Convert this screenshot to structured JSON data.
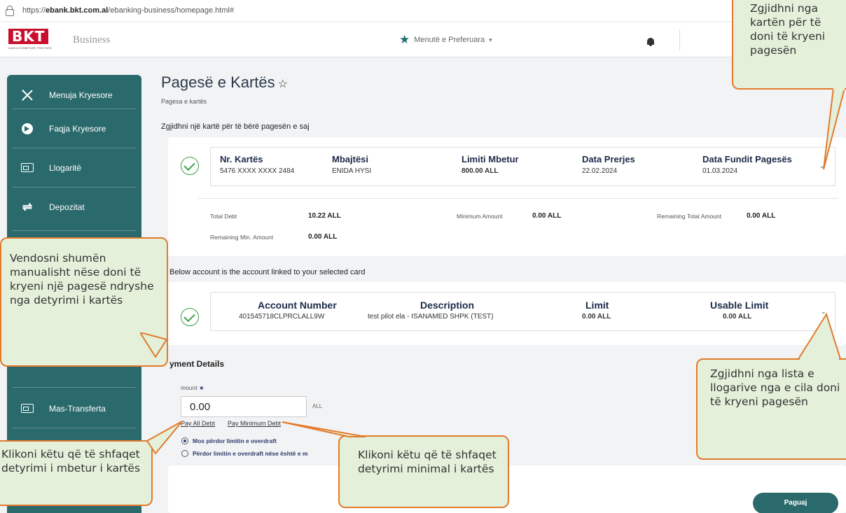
{
  "browser": {
    "url_prefix": "https://",
    "url_domain": "ebank.bkt.com.al",
    "url_path": "/ebanking-business/homepage.html#"
  },
  "header": {
    "logo_text": "BKT",
    "logo_sub": "BANKA KOMBËTARE TREGTARE",
    "business": "Business",
    "favorites": "Menutë e Preferuara",
    "favorites_icon": "star-icon"
  },
  "sidebar": {
    "items": [
      {
        "label": "Menuja Kryesore",
        "icon": "close-icon"
      },
      {
        "label": "Faqja Kryesore",
        "icon": "home-circle-icon"
      },
      {
        "label": "Llogaritë",
        "icon": "account-card-icon"
      },
      {
        "label": "Depozitat",
        "icon": "deposit-icon"
      },
      {
        "label": "Mas-Transferta",
        "icon": "account-card-icon"
      }
    ]
  },
  "main": {
    "title": "Pagesë e Kartës",
    "subtitle": "Pagesa e kartës",
    "select_card_label": "Zgjidhni një kartë për të bërë pagesën e saj",
    "card": {
      "headers": [
        "Nr. Kartës",
        "Mbajtësi",
        "Limiti Mbetur",
        "Data Prerjes",
        "Data Fundit Pagesës"
      ],
      "values": [
        "5476 XXXX XXXX 2484",
        "ENIDA HYSI",
        "800.00 ALL",
        "22.02.2024",
        "01.03.2024"
      ],
      "total_debt_label": "Total Debt",
      "total_debt": "10.22 ALL",
      "min_amount_label": "Minimum Amount",
      "min_amount": "0.00 ALL",
      "remaining_total_label": "Remaining Total Amount",
      "remaining_total": "0.00 ALL",
      "remaining_min_label": "Remaining Min. Amount",
      "remaining_min": "0.00 ALL"
    },
    "account_label": "Below account is the account linked to your selected card",
    "account": {
      "headers": [
        "Account Number",
        "Description",
        "Limit",
        "Usable Limit"
      ],
      "values": [
        "401545718CLPRCLALL9W",
        "test pilot ela - ISANAMED SHPK (TEST)",
        "0.00 ALL",
        "0.00 ALL"
      ]
    },
    "payment": {
      "section_label": "yment Details",
      "amount_label": "mount",
      "amount_value": "0.00",
      "currency": "ALL",
      "pay_all_debt": "Pay All Debt",
      "pay_min_debt": "Pay Minimum Debt",
      "radio_1": "Mos përdor limitin e overdraft",
      "radio_2": "Përdor limitin e overdraft nëse është e m"
    },
    "pay_button": "Paguaj"
  },
  "callouts": {
    "top_right": "Zgjidhni nga kartën për të doni të kryeni pagesën",
    "left": "Vendosni shumën manualisht nëse doni të kryeni një pagesë ndryshe nga detyrimi i kartës",
    "right": "Zgjidhni nga lista e llogarive nga e cila doni të kryeni pagesën",
    "bottom_left": "Klikoni këtu që të shfaqet detyrimi i mbetur i kartës",
    "bottom_mid": "Klikoni këtu që të shfaqet detyrimi minimal i kartës"
  },
  "colors": {
    "brand_teal": "#2b6a6c",
    "bkt_red": "#c8102e",
    "callout_fill": "#e4f0da",
    "callout_border": "#e27b2d",
    "check_green": "#3aa04a"
  }
}
